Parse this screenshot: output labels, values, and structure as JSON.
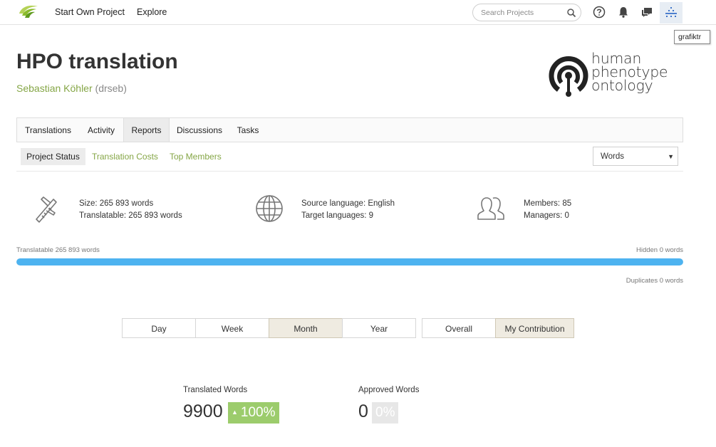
{
  "nav": {
    "start_project": "Start Own Project",
    "explore": "Explore",
    "search_placeholder": "Search Projects",
    "tooltip": "grafiktr"
  },
  "project": {
    "title": "HPO translation",
    "owner_name": "Sebastian Köhler",
    "owner_handle": "(drseb)",
    "logo_text": [
      "human",
      "phenotype",
      "ontology"
    ]
  },
  "tabs": [
    "Translations",
    "Activity",
    "Reports",
    "Discussions",
    "Tasks"
  ],
  "active_tab": "Reports",
  "subtabs": [
    "Project Status",
    "Translation Costs",
    "Top Members"
  ],
  "active_subtab": "Project Status",
  "unit_select": {
    "value": "Words"
  },
  "stats": {
    "size": "Size: 265 893 words",
    "translatable": "Translatable: 265 893 words",
    "source_language": "Source language: English",
    "target_languages": "Target languages: 9",
    "members": "Members: 85",
    "managers": "Managers: 0"
  },
  "progress": {
    "left_label": "Translatable 265 893 words",
    "right_label": "Hidden 0 words",
    "duplicates_label": "Duplicates 0 words",
    "fill_percent": 100
  },
  "period_buttons": [
    "Day",
    "Week",
    "Month",
    "Year"
  ],
  "active_period": "Month",
  "scope_buttons": [
    "Overall",
    "My Contribution"
  ],
  "active_scope": "My Contribution",
  "metrics": {
    "translated_label": "Translated Words",
    "translated_value": "9900",
    "translated_change": "100%",
    "approved_label": "Approved Words",
    "approved_value": "0",
    "approved_change": "0%"
  },
  "colors": {
    "accent_green": "#85a646",
    "badge_green": "#9ccc6c",
    "progress_blue": "#4db3f0"
  }
}
